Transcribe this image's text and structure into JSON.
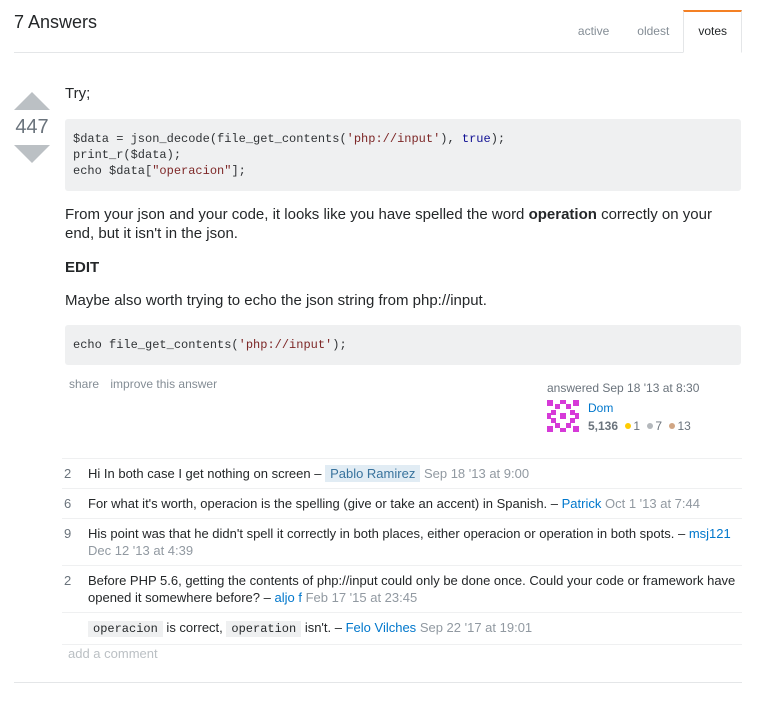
{
  "header": {
    "title": "7 Answers",
    "tabs": [
      {
        "label": "active"
      },
      {
        "label": "oldest"
      },
      {
        "label": "votes",
        "selected": true
      }
    ],
    "accent": "#f48024"
  },
  "vote": {
    "score": "447"
  },
  "post": {
    "intro": "Try;",
    "code1": [
      {
        "pre": "$data = json_decode(file_get_contents(",
        "str": "'php://input'",
        "mid": "), ",
        "kw": "true",
        "post": ");"
      },
      {
        "line": "print_r($data);"
      },
      {
        "pre": "echo $data[",
        "str": "\"operacion\"",
        "post": "];"
      }
    ],
    "para1_before": "From your json and your code, it looks like you have spelled the word ",
    "para1_bold": "operation",
    "para1_after": " correctly on your end, but it isn't in the json.",
    "edit_heading": "EDIT",
    "para2": "Maybe also worth trying to echo the json string from php://input.",
    "code2": {
      "pre": "echo file_get_contents(",
      "str": "'php://input'",
      "post": ");"
    }
  },
  "menu": {
    "share": "share",
    "improve": "improve this answer"
  },
  "signature": {
    "action": "answered Sep 18 '13 at 8:30",
    "user": "Dom",
    "reputation": "5,136",
    "gold": "1",
    "silver": "7",
    "bronze": "13",
    "badge_colors": {
      "gold": "#ffcc01",
      "silver": "#b4b8bc",
      "bronze": "#d1a684"
    }
  },
  "comments": [
    {
      "score": "2",
      "text": "Hi In both case I get nothing on screen –",
      "user": "Pablo Ramirez",
      "date": "Sep 18 '13 at 9:00"
    },
    {
      "score": "6",
      "text": "For what it's worth, operacion is the spelling (give or take an accent) in Spanish. –",
      "user": "Patrick",
      "date": "Oct 1 '13 at 7:44"
    },
    {
      "score": "9",
      "text": "His point was that he didn't spell it correctly in both places, either operacion or operation in both spots. –",
      "user": "msj121",
      "date": "Dec 12 '13 at 4:39"
    },
    {
      "score": "2",
      "text": "Before PHP 5.6, getting the contents of php://input could only be done once. Could your code or framework have opened it somewhere before? –",
      "user": "aljo f",
      "date": "Feb 17 '15 at 23:45"
    },
    {
      "score": "",
      "code1": "operacion",
      "mid": " is correct, ",
      "code2": "operation",
      "after": " isn't. –",
      "user": "Felo Vilches",
      "date": "Sep 22 '17 at 19:01"
    }
  ],
  "add_comment": "add a comment"
}
